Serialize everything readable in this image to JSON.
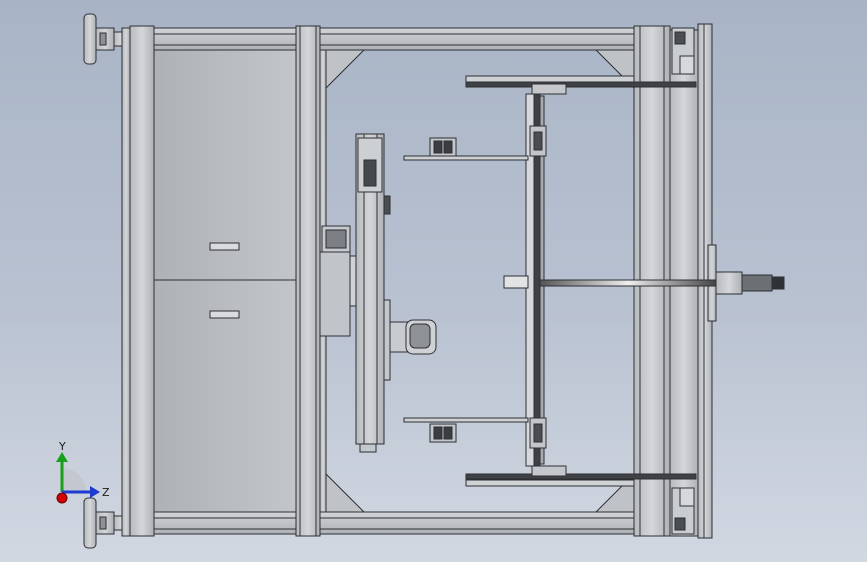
{
  "viewport": {
    "background_top": "#a8b4c6",
    "background_bottom": "#d2d8e2"
  },
  "colors": {
    "frame_fill": "#c6c9cc",
    "frame_edge": "#2d2f33",
    "panel_fill": "#b9bcc0",
    "dark_part": "#3b3e43",
    "x_axis": "#d40000",
    "y_axis": "#18a018",
    "z_axis": "#1e3ad0"
  },
  "triad": {
    "y_label": "Y",
    "z_label": "Z",
    "x_icon": "x-axis-arrow-icon",
    "y_icon": "y-axis-arrow-icon",
    "z_icon": "z-axis-arrow-icon"
  }
}
